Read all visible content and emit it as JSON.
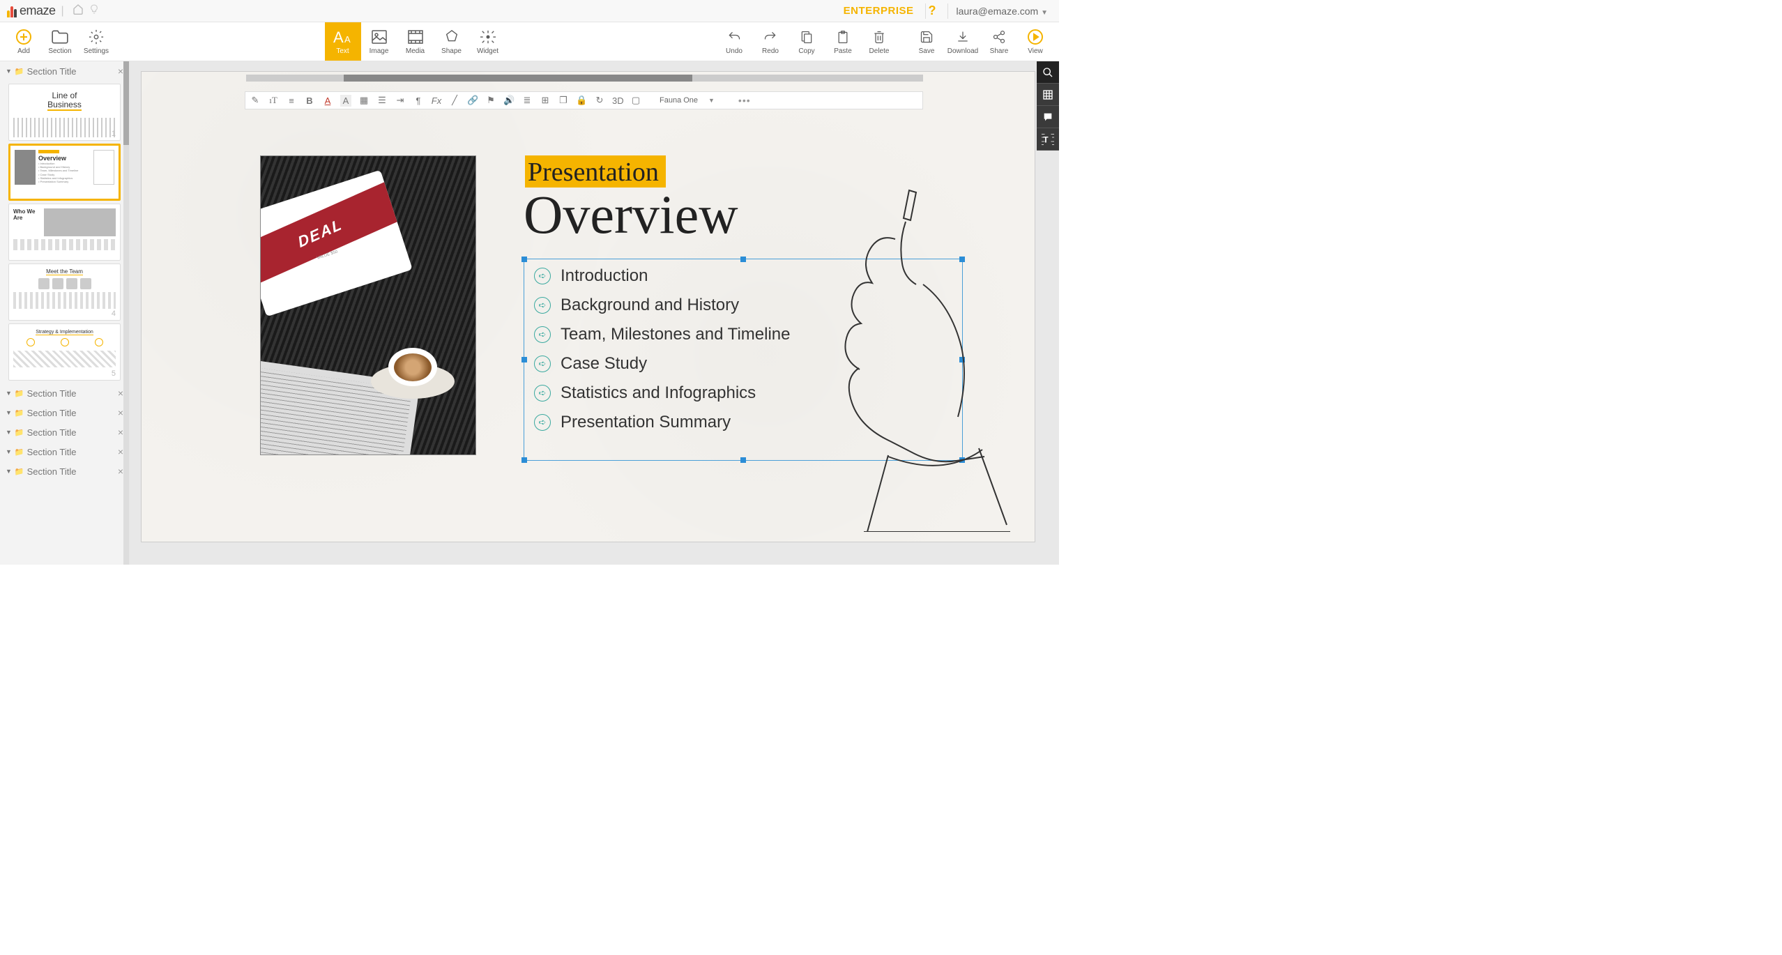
{
  "header": {
    "brand": "emaze",
    "plan": "ENTERPRISE",
    "help": "?",
    "user": "laura@emaze.com"
  },
  "toolbar": {
    "left": [
      {
        "id": "add",
        "label": "Add"
      },
      {
        "id": "section",
        "label": "Section"
      },
      {
        "id": "settings",
        "label": "Settings"
      }
    ],
    "center": [
      {
        "id": "text",
        "label": "Text",
        "active": true
      },
      {
        "id": "image",
        "label": "Image"
      },
      {
        "id": "media",
        "label": "Media"
      },
      {
        "id": "shape",
        "label": "Shape"
      },
      {
        "id": "widget",
        "label": "Widget"
      }
    ],
    "right": [
      {
        "id": "undo",
        "label": "Undo"
      },
      {
        "id": "redo",
        "label": "Redo"
      },
      {
        "id": "copy",
        "label": "Copy"
      },
      {
        "id": "paste",
        "label": "Paste"
      },
      {
        "id": "delete",
        "label": "Delete"
      },
      {
        "id": "save",
        "label": "Save"
      },
      {
        "id": "download",
        "label": "Download"
      },
      {
        "id": "share",
        "label": "Share"
      },
      {
        "id": "view",
        "label": "View"
      }
    ]
  },
  "sidebar": {
    "sections": [
      {
        "title": "Section Title",
        "expanded": true,
        "slides": [
          {
            "num": "1",
            "kind": "title",
            "line1": "Line of",
            "line2": "Business"
          },
          {
            "num": "",
            "kind": "overview",
            "label": "Overview",
            "active": true
          },
          {
            "num": "",
            "kind": "who",
            "label": "Who We Are"
          },
          {
            "num": "4",
            "kind": "team",
            "label": "Meet the Team"
          },
          {
            "num": "5",
            "kind": "strategy",
            "label": "Strategy & Implementation"
          }
        ]
      },
      {
        "title": "Section Title",
        "expanded": false
      },
      {
        "title": "Section Title",
        "expanded": false
      },
      {
        "title": "Section Title",
        "expanded": false
      },
      {
        "title": "Section Title",
        "expanded": false
      },
      {
        "title": "Section Title",
        "expanded": false
      }
    ]
  },
  "formatBar": {
    "font": "Fauna One",
    "threeD": "3D"
  },
  "slide": {
    "subtitle": "Presentation",
    "title": "Overview",
    "image_badge": "DEAL",
    "image_badge_sub": "VALUE $50",
    "bullets": [
      "Introduction",
      "Background and History",
      "Team, Milestones and Timeline",
      "Case Study",
      "Statistics and Infographics",
      "Presentation Summary"
    ]
  },
  "sideTools": {
    "items": [
      "search",
      "grid",
      "comments",
      "text-style"
    ]
  }
}
